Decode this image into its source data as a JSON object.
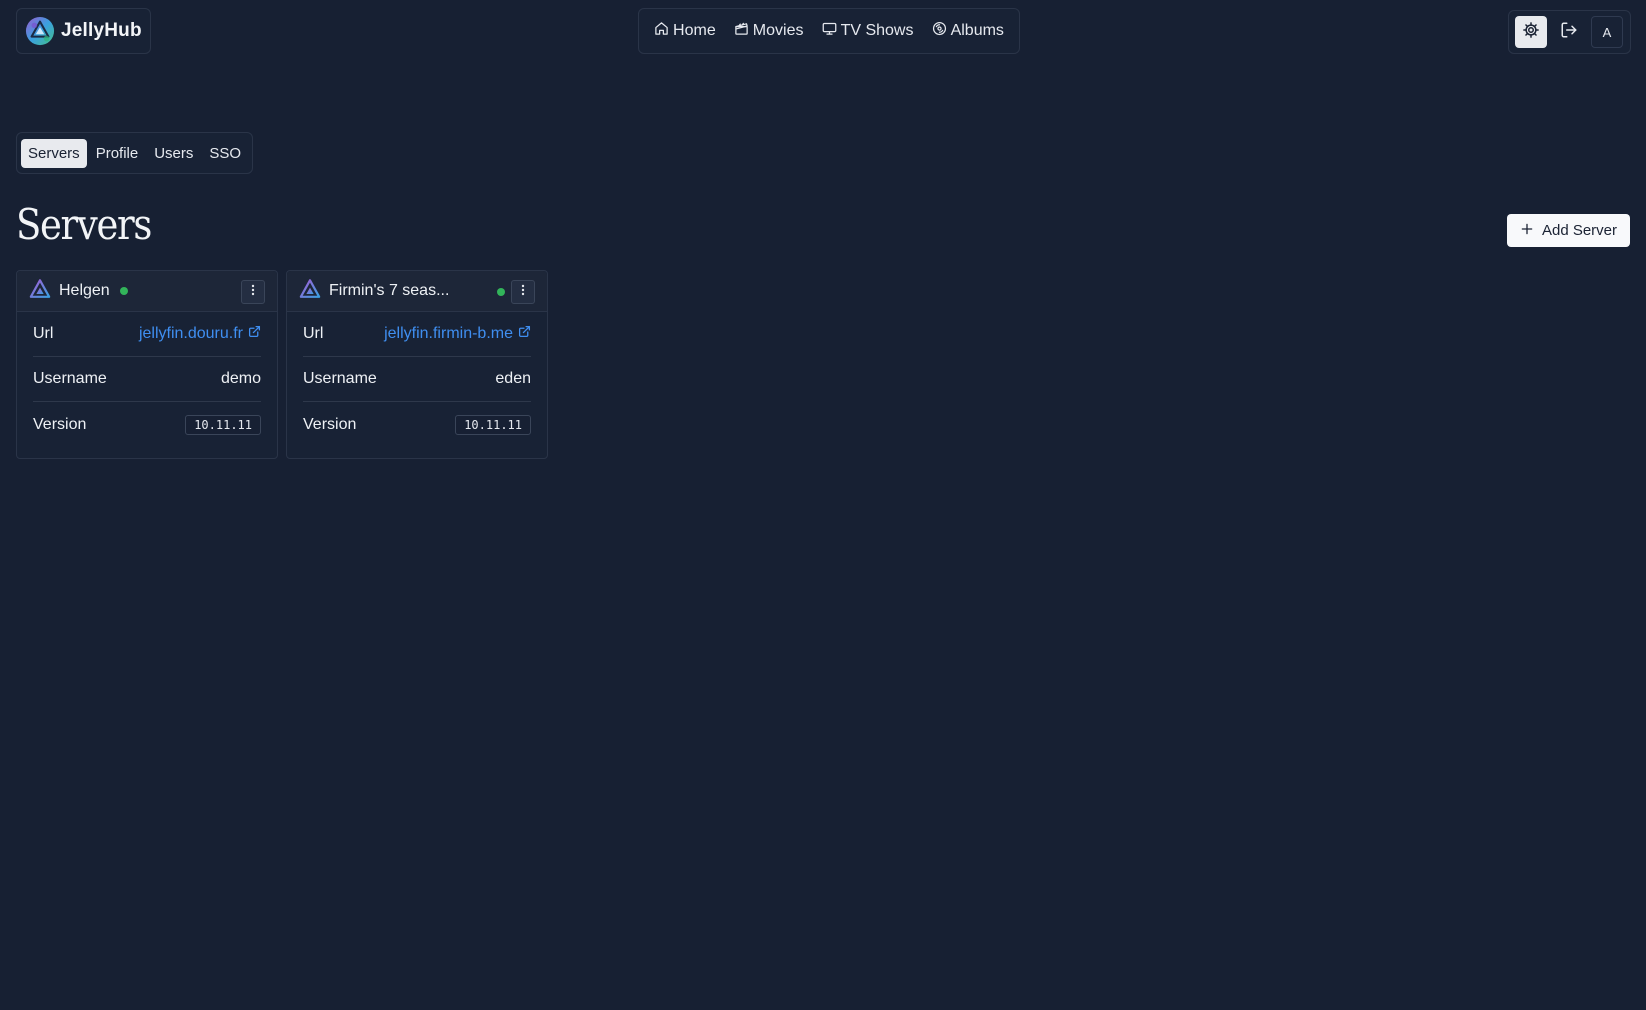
{
  "brand": {
    "name": "JellyHub",
    "logo_icon": "jellyfin-logo-icon"
  },
  "nav": {
    "items": [
      {
        "label": "Home",
        "icon": "home-icon"
      },
      {
        "label": "Movies",
        "icon": "clapperboard-icon"
      },
      {
        "label": "TV Shows",
        "icon": "tv-icon"
      },
      {
        "label": "Albums",
        "icon": "disc-icon"
      }
    ]
  },
  "header_actions": {
    "settings_icon": "gear-icon",
    "logout_icon": "logout-icon",
    "avatar_initial": "A"
  },
  "tabs": [
    {
      "label": "Servers",
      "active": true
    },
    {
      "label": "Profile",
      "active": false
    },
    {
      "label": "Users",
      "active": false
    },
    {
      "label": "SSO",
      "active": false
    }
  ],
  "page": {
    "title": "Servers",
    "add_button_label": "Add Server"
  },
  "labels": {
    "url": "Url",
    "username": "Username",
    "version": "Version"
  },
  "servers": [
    {
      "name": "Helgen",
      "status": "online",
      "url": "jellyfin.douru.fr",
      "username": "demo",
      "version": "10.11.11"
    },
    {
      "name": "Firmin's 7 seas...",
      "status": "online",
      "url": "jellyfin.firmin-b.me",
      "username": "eden",
      "version": "10.11.11"
    }
  ],
  "colors": {
    "background": "#172033",
    "link": "#3f8ef0",
    "status_online": "#32b45a",
    "accent_light": "#e8eaee"
  }
}
